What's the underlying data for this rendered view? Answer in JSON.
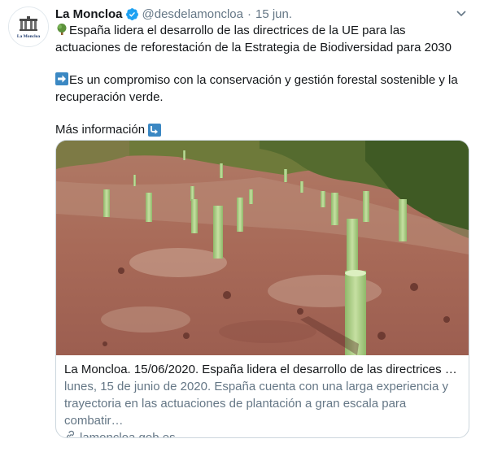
{
  "tweet": {
    "author_name": "La Moncloa",
    "handle": "@desdelamoncloa",
    "separator": "·",
    "date": "15 jun.",
    "avatar_label": "La Moncloa",
    "line1": "España lidera el desarrollo de las directrices de la UE para las actuaciones de reforestación de la Estrategia de Biodiversidad para 2030",
    "line2": "Es un compromiso con la conservación y gestión forestal sostenible y la recuperación verde.",
    "line3": "Más información",
    "icons": [
      "tree-emoji-icon",
      "right-arrow-emoji-icon",
      "down-right-arrow-emoji-icon"
    ]
  },
  "card": {
    "title": "La Moncloa. 15/06/2020. España lidera el desarrollo de las directrices co…",
    "description": "lunes, 15 de junio de 2020. España cuenta con una larga experiencia y trayectoria en las actuaciones de plantación a gran escala para combatir…",
    "domain": "lamoncloa.gob.es",
    "image_alt_subject": "tree-planting-tubes-on-red-soil"
  },
  "colors": {
    "text": "#14171a",
    "muted": "#657786",
    "verified": "#1da1f2",
    "border": "#ccd6dd",
    "emoji_blue": "#3b88c3"
  }
}
